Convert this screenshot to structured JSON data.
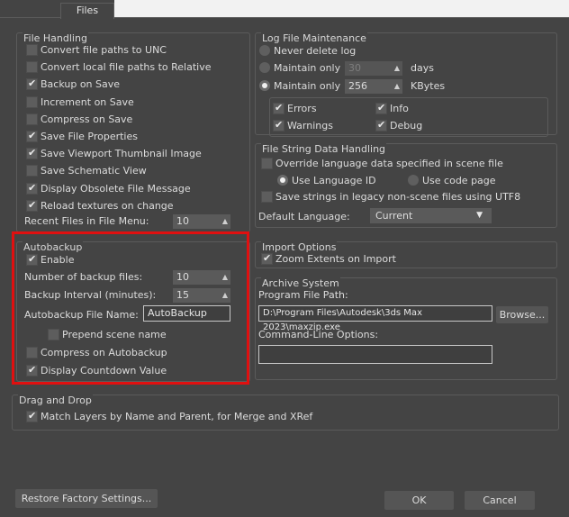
{
  "tabs": {
    "files": "Files"
  },
  "file_handling": {
    "title": "File Handling",
    "items": [
      {
        "label": "Convert file paths to UNC",
        "checked": false
      },
      {
        "label": "Convert local file paths to Relative",
        "checked": false
      },
      {
        "label": "Backup on Save",
        "checked": true
      },
      {
        "label": "Increment on Save",
        "checked": false
      },
      {
        "label": "Compress on Save",
        "checked": false
      },
      {
        "label": "Save File Properties",
        "checked": true
      },
      {
        "label": "Save Viewport Thumbnail Image",
        "checked": true
      },
      {
        "label": "Save Schematic View",
        "checked": false
      },
      {
        "label": "Display Obsolete File Message",
        "checked": true
      },
      {
        "label": "Reload textures on change",
        "checked": true
      }
    ],
    "recent_files_label": "Recent Files in File Menu:",
    "recent_files_value": "10"
  },
  "autobackup": {
    "title": "Autobackup",
    "enable_label": "Enable",
    "num_backup_label": "Number of backup files:",
    "num_backup_value": "10",
    "interval_label": "Backup Interval (minutes):",
    "interval_value": "15",
    "filename_label": "Autobackup File Name:",
    "filename_value": "AutoBackup",
    "prepend_label": "Prepend scene name",
    "compress_label": "Compress on Autobackup",
    "countdown_label": "Display Countdown Value"
  },
  "drag_drop": {
    "title": "Drag and Drop",
    "match_label": "Match Layers by Name and Parent, for Merge and XRef"
  },
  "log": {
    "title": "Log File Maintenance",
    "never_label": "Never delete log",
    "maintain1_label": "Maintain only",
    "maintain1_value": "30",
    "days_label": "days",
    "maintain2_label": "Maintain only",
    "maintain2_value": "256",
    "kbytes_label": "KBytes",
    "errors_label": "Errors",
    "info_label": "Info",
    "warnings_label": "Warnings",
    "debug_label": "Debug"
  },
  "string_data": {
    "title": "File String Data Handling",
    "override_label": "Override language data specified in scene file",
    "use_language_label": "Use Language ID",
    "use_codepage_label": "Use code page",
    "save_strings_label": "Save strings in legacy non-scene files using UTF8",
    "default_lang_label": "Default Language:",
    "default_lang_value": "Current"
  },
  "import": {
    "title": "Import Options",
    "zoom_label": "Zoom Extents on Import"
  },
  "archive": {
    "title": "Archive System",
    "path_label": "Program File Path:",
    "path_value": "D:\\Program Files\\Autodesk\\3ds Max 2023\\maxzip.exe",
    "browse_label": "Browse...",
    "cmdline_label": "Command-Line Options:",
    "cmdline_value": ""
  },
  "footer": {
    "restore_label": "Restore Factory Settings...",
    "ok_label": "OK",
    "cancel_label": "Cancel"
  },
  "colors": {
    "highlight": "#e01010",
    "background": "#444444"
  }
}
